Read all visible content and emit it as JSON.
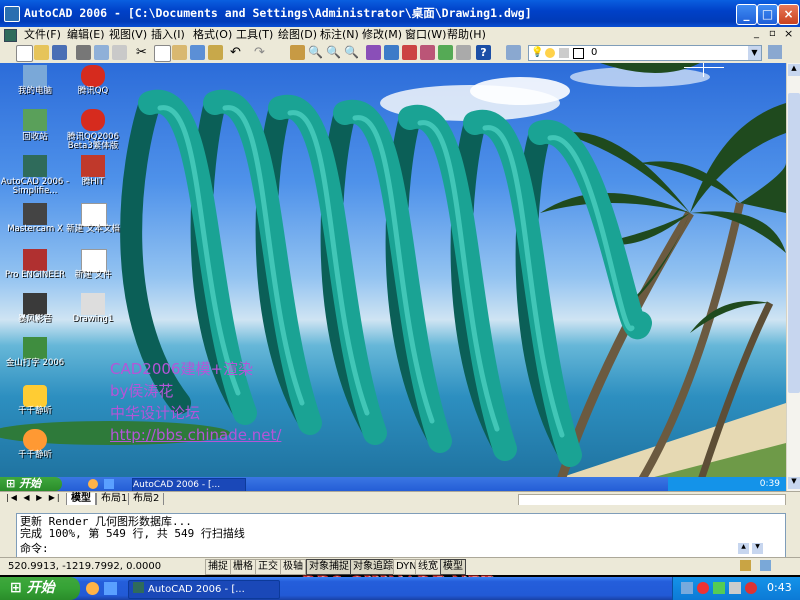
{
  "window": {
    "title": "AutoCAD 2006 - [C:\\Documents and Settings\\Administrator\\桌面\\Drawing1.dwg]",
    "minimize": "_",
    "maximize": "□",
    "close": "×"
  },
  "menu": [
    "文件(F)",
    "编辑(E)",
    "视图(V)",
    "插入(I)",
    "格式(O)",
    "工具(T)",
    "绘图(D)",
    "标注(N)",
    "修改(M)",
    "窗口(W)",
    "帮助(H)"
  ],
  "toolbar": {
    "layer_value": "0"
  },
  "desktop_icons": [
    {
      "label": "我的电脑",
      "icon": "my-computer-icon",
      "color": "#7aa8d8"
    },
    {
      "label": "腾讯QQ",
      "icon": "qq-penguin-icon",
      "color": "#d62b1e"
    },
    {
      "label": "回收站",
      "icon": "recycle-bin-icon",
      "color": "#5aa05a"
    },
    {
      "label": "腾讯QQ2006 Beta3繁体版",
      "icon": "qq2006-icon",
      "color": "#d62b1e"
    },
    {
      "label": "AutoCAD 2006 - Simplifie...",
      "icon": "autocad-icon",
      "color": "#2f6b5b"
    },
    {
      "label": "腾HIT",
      "icon": "tencent-hit-icon",
      "color": "#c0392b"
    },
    {
      "label": "Mastercam X",
      "icon": "mastercam-icon",
      "color": "#444444"
    },
    {
      "label": "新建 文本文档",
      "icon": "text-document-icon",
      "color": "#ffffff"
    },
    {
      "label": "Pro ENGINEER",
      "icon": "pro-engineer-icon",
      "color": "#b03030"
    },
    {
      "label": "新建 文件",
      "icon": "new-document-icon",
      "color": "#ffffff"
    },
    {
      "label": "暴风影音",
      "icon": "storm-player-icon",
      "color": "#3a3a3a"
    },
    {
      "label": "Drawing1",
      "icon": "drawing-file-icon",
      "color": "#dddddd"
    },
    {
      "label": "金山打字 2006",
      "icon": "typing-icon",
      "color": "#3f8d3f"
    },
    {
      "label": "千千静听",
      "icon": "music-player-icon",
      "color": "#ffcc33"
    },
    {
      "label": "千千静听",
      "icon": "media-icon",
      "color": "#ff9933"
    }
  ],
  "watermark": [
    "CAD2006建模+渲染",
    "by侯涛花",
    "中华设计论坛",
    "http://bbs.chinade.net/"
  ],
  "inner_taskbar": {
    "start": "开始",
    "task": "AutoCAD 2006 - [...",
    "clock": "0:39"
  },
  "tabs": [
    "模型",
    "布局1",
    "布局2"
  ],
  "command_lines": [
    "更新 Render 几何图形数据库...",
    "完成 100%, 第 549 行, 共 549 行扫描线",
    "命令:"
  ],
  "status": {
    "coords": "520.9913,  -1219.7992,  0.0000",
    "buttons": [
      {
        "label": "捕捉",
        "on": false
      },
      {
        "label": "栅格",
        "on": false
      },
      {
        "label": "正交",
        "on": false
      },
      {
        "label": "极轴",
        "on": false
      },
      {
        "label": "对象捕捉",
        "on": true
      },
      {
        "label": "对象追踪",
        "on": true
      },
      {
        "label": "DYN",
        "on": false
      },
      {
        "label": "线宽",
        "on": false
      },
      {
        "label": "模型",
        "on": true
      }
    ]
  },
  "footer_watermark": "BBS.CHINADE.NET",
  "taskbar": {
    "start": "开始",
    "task": "AutoCAD 2006 - [...",
    "clock": "0:43"
  },
  "colors": {
    "spring": "#1aa394",
    "spring_dark": "#0b5f57",
    "watermark": "#b455d8",
    "xp_blue": "#245edb",
    "start_green": "#35a235"
  }
}
